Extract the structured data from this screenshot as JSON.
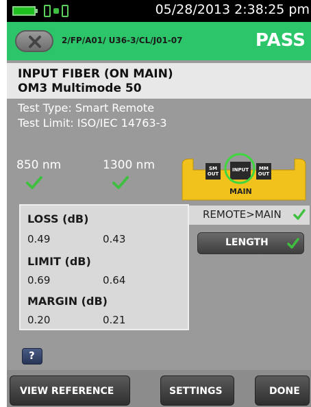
{
  "status_bar": {
    "datetime": "05/28/2013 2:38:25 pm",
    "battery_icon": "battery-icon",
    "connection_icon": "link-status-icon"
  },
  "header": {
    "back_icon": "x-icon",
    "path": "2/FP/A01/ U36-3/CL/J01-07",
    "result": "PASS",
    "accent_color": "#2cc56a"
  },
  "fiber": {
    "title": "INPUT FIBER (ON MAIN)",
    "type": "OM3 Multimode 50"
  },
  "test": {
    "type": "Test Type: Smart Remote",
    "limit": "Test Limit: ISO/IEC 14763-3"
  },
  "wavelengths": [
    {
      "label": "850 nm",
      "status": "pass"
    },
    {
      "label": "1300 nm",
      "status": "pass"
    }
  ],
  "device": {
    "ports": [
      "SM OUT",
      "INPUT",
      "MM OUT"
    ],
    "label": "MAIN"
  },
  "results": {
    "loss_label": "LOSS (dB)",
    "loss_values": [
      "0.49",
      "0.43"
    ],
    "limit_label": "LIMIT (dB)",
    "limit_values": [
      "0.69",
      "0.64"
    ],
    "margin_label": "MARGIN (dB)",
    "margin_values": [
      "0.20",
      "0.21"
    ]
  },
  "direction": "REMOTE>MAIN",
  "length_button": "LENGTH",
  "help_label": "?",
  "bottom": {
    "view_reference": "VIEW REFERENCE",
    "settings": "SETTINGS",
    "done": "DONE"
  }
}
